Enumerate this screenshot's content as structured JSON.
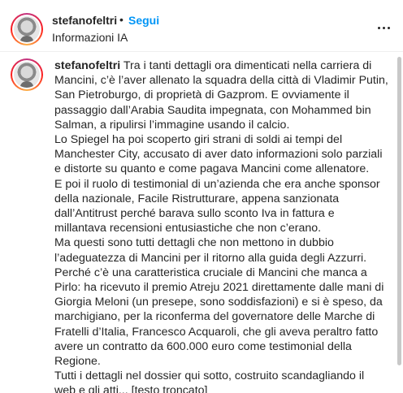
{
  "header": {
    "username": "stefanofeltri",
    "separator": "•",
    "follow_label": "Segui",
    "subtitle": "Informazioni IA",
    "more_icon": "more-horizontal-icon"
  },
  "caption": {
    "username": "stefanofeltri",
    "lines": [
      " Tra i tanti dettagli ora dimenticati nella carriera di",
      "Mancini, c’è l’aver allenato la squadra della città di Vladimir Putin,",
      "San Pietroburgo, di proprietà di Gazprom. E ovviamente il",
      "passaggio dall’Arabia Saudita impegnata, con Mohammed bin",
      "Salman, a ripulirsi l’immagine usando il calcio.",
      "Lo Spiegel ha poi scoperto giri strani di soldi ai tempi del",
      "Manchester City, accusato di aver dato informazioni solo parziali",
      "e distorte su quanto e come pagava Mancini come allenatore.",
      "E poi il ruolo di testimonial di un’azienda che era anche sponsor",
      "della nazionale, Facile Ristrutturare, appena sanzionata",
      "dall’Antitrust perché barava sullo sconto Iva in fattura e",
      "millantava recensioni entusiastiche che non c’erano.",
      "Ma questi sono tutti dettagli che non mettono in dubbio",
      "l’adeguatezza di Mancini per il ritorno alla guida degli Azzurri.",
      "Perché c’è una caratteristica cruciale di Mancini che manca a",
      "Pirlo: ha ricevuto il premio Atreju 2021 direttamente dalle mani di",
      "Giorgia Meloni (un presepe, sono soddisfazioni) e si è speso, da",
      "marchigiano, per la riconferma del governatore delle Marche di",
      "Fratelli d’Italia, Francesco Acquaroli, che gli aveva peraltro fatto",
      "avere un contratto da 600.000 euro come testimonial della",
      "Regione.",
      "Tutti i dettagli nel dossier qui sotto, costruito scandagliando il",
      "web e gli atti... [testo troncato]"
    ]
  },
  "colors": {
    "follow": "#0095f6",
    "text": "#262626"
  }
}
